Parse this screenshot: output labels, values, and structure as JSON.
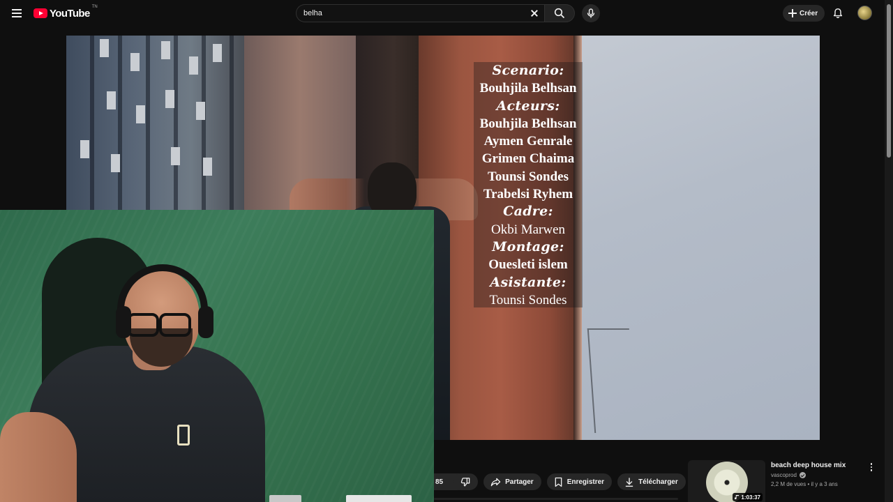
{
  "header": {
    "logo_text": "YouTube",
    "logo_tm": "TN",
    "search_value": "belha",
    "create_label": "Créer"
  },
  "credits": [
    {
      "text": "Scenario:",
      "kind": "heading"
    },
    {
      "text": "Bouhjila Belhsan",
      "kind": "name"
    },
    {
      "text": "Acteurs:",
      "kind": "heading"
    },
    {
      "text": "Bouhjila Belhsan",
      "kind": "name"
    },
    {
      "text": "Aymen Genrale",
      "kind": "name"
    },
    {
      "text": "Grimen Chaima",
      "kind": "name"
    },
    {
      "text": "Tounsi Sondes",
      "kind": "name"
    },
    {
      "text": "Trabelsi Ryhem",
      "kind": "name"
    },
    {
      "text": "Cadre:",
      "kind": "heading"
    },
    {
      "text": "Okbi Marwen",
      "kind": "name-regular"
    },
    {
      "text": "Montage:",
      "kind": "heading"
    },
    {
      "text": "Ouesleti islem",
      "kind": "name"
    },
    {
      "text": "Asistante:",
      "kind": "heading"
    },
    {
      "text": "Tounsi Sondes",
      "kind": "name-regular"
    }
  ],
  "actions": {
    "like_count": "85",
    "share_label": "Partager",
    "save_label": "Enregistrer",
    "download_label": "Télécharger"
  },
  "recommendation": {
    "title": "beach deep house mix",
    "channel": "vascoprod",
    "meta": "2,2 M de vues • il y a 3 ans",
    "duration": "1:03:37"
  },
  "icons": {
    "menu": "menu-icon",
    "search": "search-icon",
    "clear": "close-icon",
    "mic": "mic-icon",
    "create": "plus-icon",
    "notifications": "bell-icon",
    "dislike": "thumbs-down-icon",
    "share": "share-icon",
    "save": "bookmark-icon",
    "download": "download-icon",
    "more": "more-horizontal-icon"
  },
  "colors": {
    "brand": "#ff0033",
    "background": "#0f0f0f",
    "chip": "#272727",
    "text": "#f1f1f1",
    "muted_text": "#aaaaaa"
  }
}
